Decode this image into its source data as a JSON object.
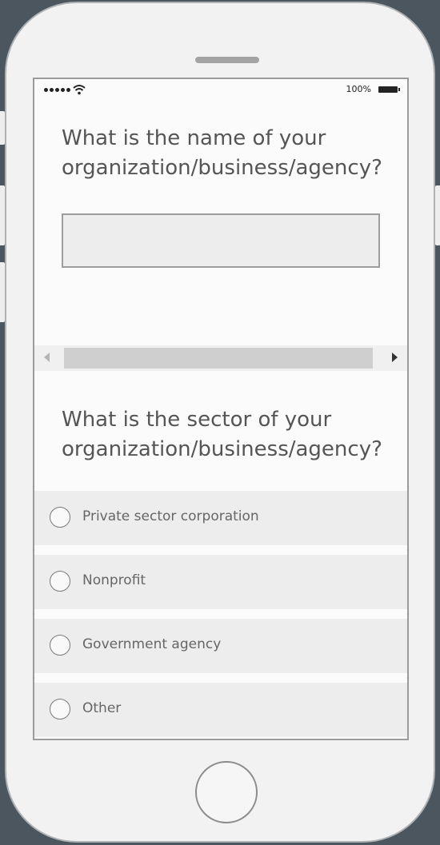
{
  "status_bar": {
    "battery_label": "100%",
    "signal_icon": "signal-dots-icon",
    "wifi_icon": "wifi-icon",
    "battery_icon": "battery-icon"
  },
  "question1": {
    "text": "What is the name of your organization/business/agency?",
    "input_value": ""
  },
  "question2": {
    "text": "What is the sector of your organization/business/agency?",
    "options": [
      {
        "label": "Private sector corporation"
      },
      {
        "label": "Nonprofit"
      },
      {
        "label": "Government agency"
      },
      {
        "label": "Other"
      }
    ]
  },
  "colors": {
    "background": "#4c565e",
    "phone_body": "#f2f2f2",
    "screen": "#fbfbfb",
    "option_row": "#ededed"
  }
}
